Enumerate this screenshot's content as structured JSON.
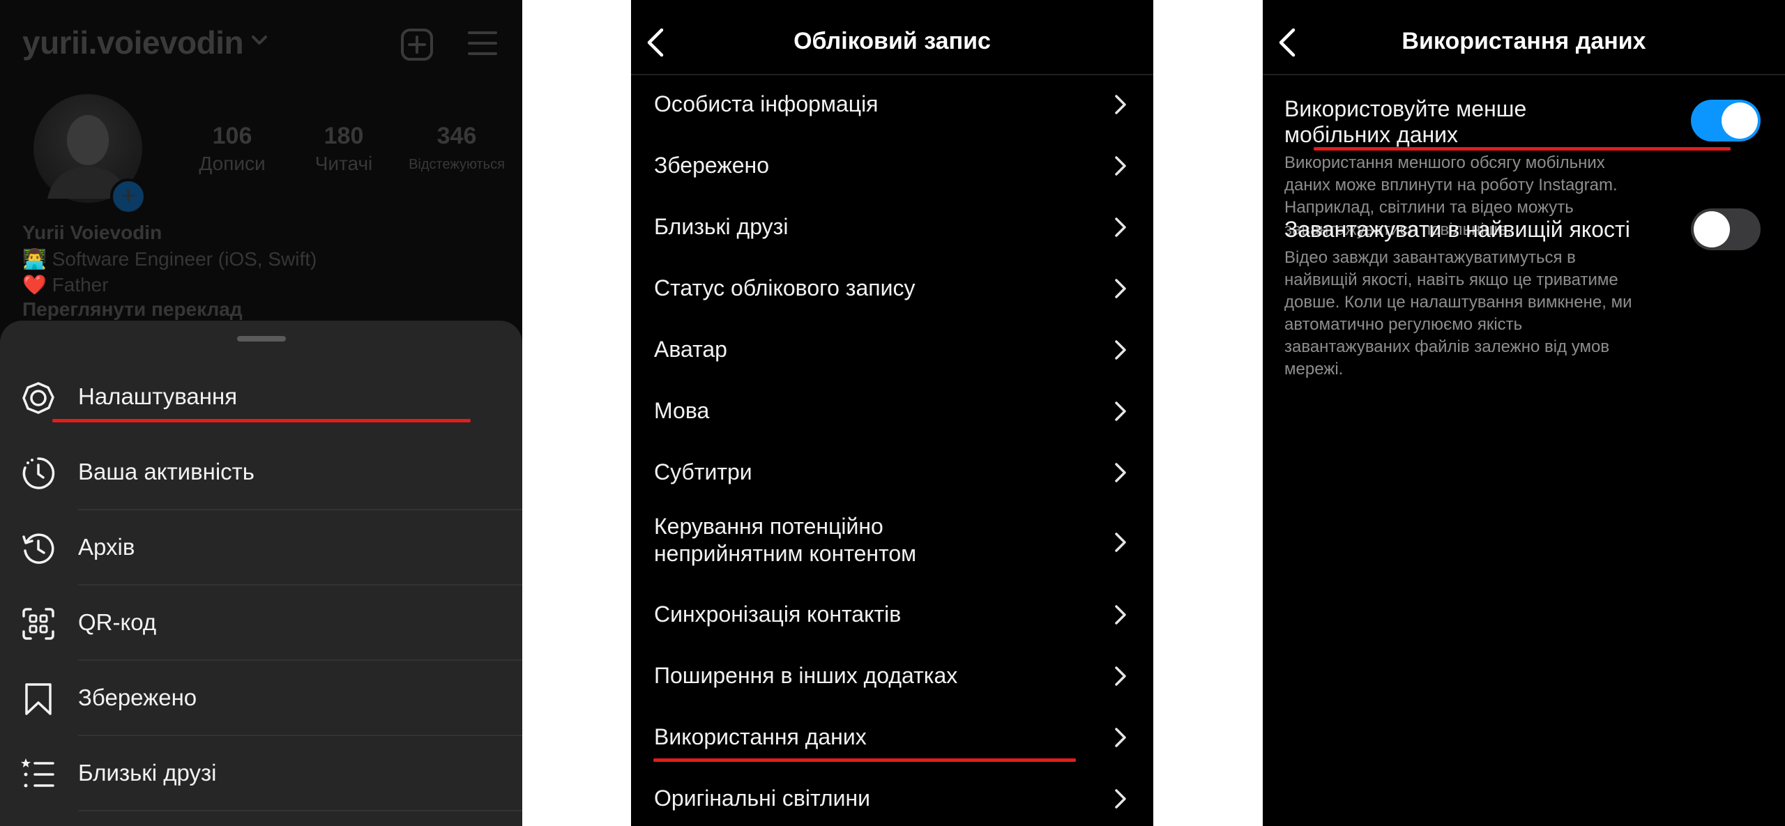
{
  "profile_panel": {
    "username": "yurii.voievodin",
    "stats": [
      {
        "value": "106",
        "label": "Дописи"
      },
      {
        "value": "180",
        "label": "Читачі"
      },
      {
        "value": "346",
        "label": "Відстежуються"
      }
    ],
    "name": "Yurii Voievodin",
    "bio_line1": "👨‍💻 Software Engineer (iOS, Swift)",
    "bio_line2": "❤️ Father",
    "translate_link": "Переглянути переклад",
    "menu": [
      {
        "label": "Налаштування",
        "icon": "gear-icon"
      },
      {
        "label": "Ваша активність",
        "icon": "activity-icon"
      },
      {
        "label": "Архів",
        "icon": "archive-icon"
      },
      {
        "label": "QR-код",
        "icon": "qr-code-icon"
      },
      {
        "label": "Збережено",
        "icon": "bookmark-icon"
      },
      {
        "label": "Близькі друзі",
        "icon": "close-friends-icon"
      }
    ]
  },
  "account_panel": {
    "title": "Обліковий запис",
    "rows": [
      {
        "label": "Особиста інформація"
      },
      {
        "label": "Збережено"
      },
      {
        "label": "Близькі друзі"
      },
      {
        "label": "Статус облікового запису"
      },
      {
        "label": "Аватар"
      },
      {
        "label": "Мова"
      },
      {
        "label": "Субтитри"
      },
      {
        "label": "Керування потенційно"
      },
      {
        "label": "Синхронізація контактів"
      },
      {
        "label": "Поширення в інших додатках"
      },
      {
        "label": "Використання даних"
      },
      {
        "label": "Оригінальні світлини"
      }
    ],
    "row8_line2": "неприйнятним контентом"
  },
  "data_usage_panel": {
    "title": "Використання даних",
    "option1": {
      "title_line1": "Використовуйте менше",
      "title_line2": "мобільних даних",
      "desc_line1": "Використання меншого обсягу мобільних",
      "desc_line2": "даних може вплинути на роботу Instagram.",
      "desc_line3": "Наприклад, світлини та відео можуть",
      "desc_line4": "завантажуватися повільніше.",
      "enabled": true
    },
    "option2": {
      "title": "Завантажувати в найвищій якості",
      "desc_line1": "Відео завжди завантажуватимуться в",
      "desc_line2": "найвищій якості, навіть якщо це триватиме",
      "desc_line3": "довше. Коли це налаштування вимкнене, ми",
      "desc_line4": "автоматично регулюємо якість",
      "desc_line5": "завантажуваних файлів залежно від умов",
      "desc_line6": "мережі.",
      "enabled": false
    }
  },
  "colors": {
    "toggle_on": "#0a95ff",
    "toggle_off": "#3a3a3c",
    "annotation_red": "#e11d1d"
  }
}
